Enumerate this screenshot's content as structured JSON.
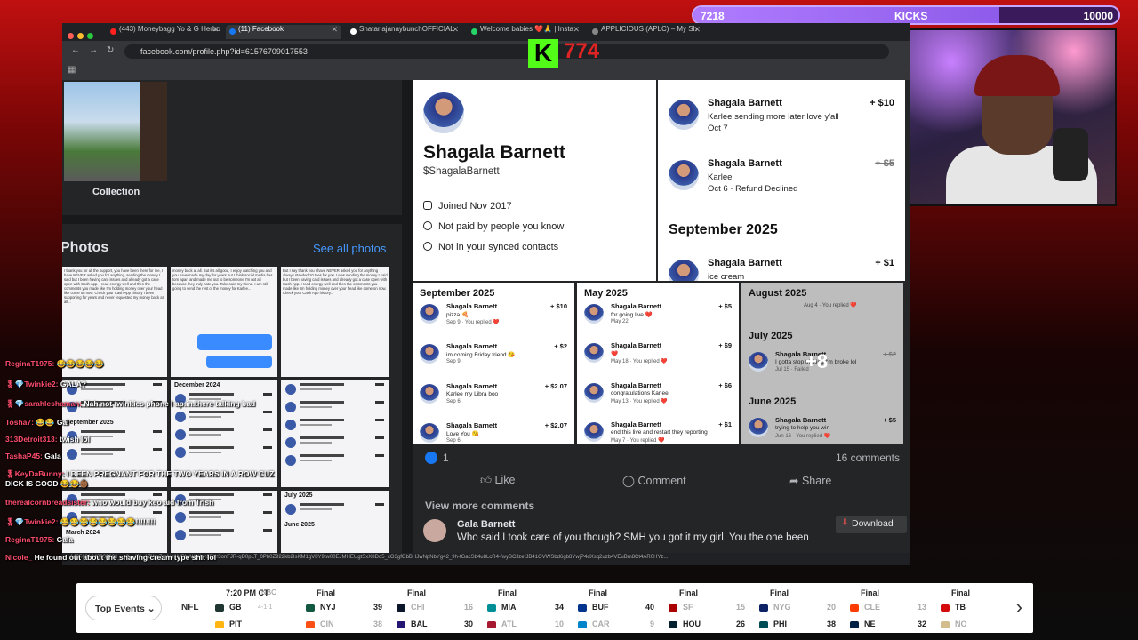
{
  "kicks": {
    "left": "7218",
    "label": "KICKS",
    "right": "10000",
    "progress": 0.72
  },
  "overlay": {
    "kick_logo": "K",
    "kick_count": "774"
  },
  "browser": {
    "tabs": [
      {
        "label": "(443) Moneybagg Yo & G Herbo",
        "color": "#ff2020"
      },
      {
        "label": "(11) Facebook",
        "color": "#1877f2",
        "active": true
      },
      {
        "label": "ShatariajanaybunchOFFICIAL",
        "color": "#fff"
      },
      {
        "label": "Welcome babies ❤️🙏 | Insta",
        "color": "#25d366"
      },
      {
        "label": "APPLICIOUS (APLC) – My Sh",
        "color": "#888"
      }
    ],
    "url": "facebook.com/profile.php?id=61576709017553",
    "status_url": "...1435691048903006__cft__[0]=AZWgZmIwr1MBbW4Ukm55Yr3onFJR-qD0pLT_0Pb0Z922kb2IsKM1gV8Y9tw00EJMHEUgtSxX8Do5_cO3gfGbBHJwNpNbYg42_9h-tGacSb4u8LcR4-fwyBCJzefJB41OVWSbd6gb8YwjP4dXsq2uzb4VEuBm8Ct4AR0HYz..."
  },
  "left": {
    "collection_label": "Collection",
    "photos_title": "Photos",
    "see_all": "See all photos",
    "thumb_months": [
      "December 2024",
      "September 2025",
      "July 2025",
      "June 2025",
      "March 2024"
    ]
  },
  "profile": {
    "name": "Shagala Barnett",
    "handle": "$ShagalaBarnett",
    "joined": "Joined Nov 2017",
    "not_paid": "Not paid by people you know",
    "not_synced": "Not in your synced contacts"
  },
  "transactions": [
    {
      "name": "Shagala Barnett",
      "line1": "Karlee sending more later love y'all",
      "line2": "Oct 7",
      "amount": "+ $10",
      "strike": false
    },
    {
      "name": "Shagala Barnett",
      "line1": "Karlee",
      "line2": "Oct 6 · Refund Declined",
      "amount": "+ $5",
      "strike": true
    }
  ],
  "tx_month": "September 2025",
  "tx_peek": {
    "name": "Shagala Barnett",
    "line1": "ice cream",
    "amount": "+ $1"
  },
  "grid": [
    {
      "month": "September 2025",
      "rows": [
        {
          "name": "Shagala Barnett",
          "d1": "pizza 🍕",
          "d2": "Sep 9 · You replied ❤️",
          "amt": "+ $10"
        },
        {
          "name": "Shagala Barnett",
          "d1": "im coming Friday friend 😘",
          "d2": "Sep 9",
          "amt": "+ $2"
        },
        {
          "name": "Shagala Barnett",
          "d1": "Karlee my Libra boo",
          "d2": "Sep 6",
          "amt": "+ $2.07"
        },
        {
          "name": "Shagala Barnett",
          "d1": "Love You 😘",
          "d2": "Sep 6",
          "amt": "+ $2.07"
        }
      ]
    },
    {
      "month": "May 2025",
      "rows": [
        {
          "name": "Shagala Barnett",
          "d1": "for going live ❤️",
          "d2": "May 22",
          "amt": "+ $5"
        },
        {
          "name": "Shagala Barnett",
          "d1": "❤️",
          "d2": "May 18 · You replied ❤️",
          "amt": "+ $9"
        },
        {
          "name": "Shagala Barnett",
          "d1": "congratulations Karlee",
          "d2": "May 13 · You replied ❤️",
          "amt": "+ $6"
        },
        {
          "name": "Shagala Barnett",
          "d1": "end this live and restart they reporting",
          "d2": "May 7 · You replied ❤️",
          "amt": "+ $1"
        }
      ]
    },
    {
      "month": "August 2025",
      "month2": "July 2025",
      "month3": "June 2025",
      "plus": "+8",
      "rows": [
        {
          "name": "Shagala Barnett",
          "d1": "I gotta stop tricking I'm broke lol",
          "d2": "Jul 15 · Failed",
          "amt": "+ $2",
          "strike": true
        },
        {
          "name": "Shagala Barnett",
          "d1": "trying to help you win",
          "d2": "Jun 16 · You replied ❤️",
          "amt": "+ $5"
        }
      ],
      "top_line": "Aug 4 · You replied ❤️"
    }
  ],
  "post": {
    "likes": "1",
    "comments": "16 comments",
    "like_label": "Like",
    "comment_label": "Comment",
    "share_label": "Share",
    "view_more": "View more comments",
    "commenter": "Gala Barnett",
    "comment_text": "Who said I took care of you though? SMH you got it my girl. You the one been",
    "download": "Download"
  },
  "chat": [
    {
      "user": "ReginaT1975:",
      "text": " 😂😂😂😂😂"
    },
    {
      "user": "🎖💎Twinkie2:",
      "text": " GALA?"
    },
    {
      "user": "🎖💎sarahleshaman:",
      "text": " Nah not twinkies phone I ap.in.there talking bad"
    },
    {
      "user": "Tosha7:",
      "text": " 😂😂 Gal"
    },
    {
      "user": "313Detroit313:",
      "text": " twish lol"
    },
    {
      "user": "TashaP45:",
      "text": " Gala"
    },
    {
      "user": "🎖KeyDaBunny:",
      "text": " I BEEN PREGNANT FOR THE TWO YEARS IN A ROW CUZ DICK IS GOOD 😂😂👶🏾"
    },
    {
      "user": "therealcornbreadsister:",
      "text": " who would buy keo aid from Trish"
    },
    {
      "user": "🎖💎Twinkie2:",
      "text": " 😂😂😂😂😂😂😂😂!!!!!!!!"
    },
    {
      "user": "ReginaT1975:",
      "text": " Gala"
    },
    {
      "user": "Nicole_",
      "text": " He found out about the shaving cream type shit lol"
    }
  ],
  "ticker": {
    "top_events": "Top Events",
    "league": "NFL",
    "games": [
      {
        "status": "7:20 PM CT",
        "network": "NBC",
        "t1": "GB",
        "r1": "4-1-1",
        "s1": "",
        "t2": "PIT",
        "r2": "",
        "s2": "",
        "c1": "#203731",
        "c2": "#ffb612"
      },
      {
        "status": "Final",
        "t1": "NYJ",
        "s1": "39",
        "t2": "CIN",
        "s2": "38",
        "lo2": true,
        "c1": "#125740",
        "c2": "#fb4f14"
      },
      {
        "status": "Final",
        "t1": "CHI",
        "s1": "16",
        "lo1": true,
        "t2": "BAL",
        "s2": "30",
        "c1": "#0b162a",
        "c2": "#241773"
      },
      {
        "status": "Final",
        "t1": "MIA",
        "s1": "34",
        "t2": "ATL",
        "s2": "10",
        "lo2": true,
        "c1": "#008e97",
        "c2": "#a71930"
      },
      {
        "status": "Final",
        "t1": "BUF",
        "s1": "40",
        "t2": "CAR",
        "s2": "9",
        "lo2": true,
        "c1": "#00338d",
        "c2": "#0085ca"
      },
      {
        "status": "Final",
        "t1": "SF",
        "s1": "15",
        "lo1": true,
        "t2": "HOU",
        "s2": "26",
        "c1": "#aa0000",
        "c2": "#03202f"
      },
      {
        "status": "Final",
        "t1": "NYG",
        "s1": "20",
        "lo1": true,
        "t2": "PHI",
        "s2": "38",
        "c1": "#0b2265",
        "c2": "#004c54"
      },
      {
        "status": "Final",
        "t1": "CLE",
        "s1": "13",
        "lo1": true,
        "t2": "NE",
        "s2": "32",
        "c1": "#ff3c00",
        "c2": "#002244"
      },
      {
        "status": "Final",
        "t1": "TB",
        "s1": "",
        "t2": "NO",
        "s2": "",
        "lo2": true,
        "c1": "#d50a0a",
        "c2": "#d3bc8d"
      }
    ]
  }
}
